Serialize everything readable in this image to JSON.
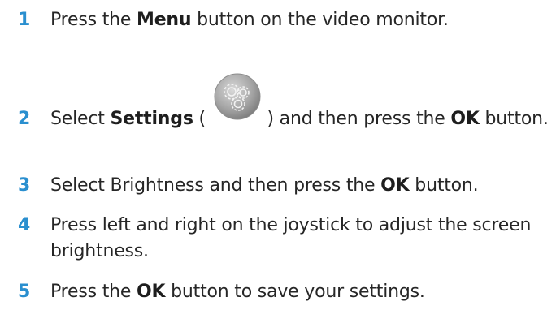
{
  "steps": [
    {
      "number": "1",
      "pre": "Press the ",
      "bold": "Menu",
      "post": " button on the video monitor."
    },
    {
      "number": "2",
      "pre": "Select ",
      "bold": "Settings",
      "mid": " ( ",
      "mid2": " ) and then press the ",
      "bold2": "OK",
      "post": " button.",
      "icon": "settings-gears-icon"
    },
    {
      "number": "3",
      "pre": "Select Brightness and then press the ",
      "bold": "OK",
      "post": " button."
    },
    {
      "number": "4",
      "pre": "Press left and right on the joystick to adjust the screen brightness."
    },
    {
      "number": "5",
      "pre": "Press the ",
      "bold": "OK",
      "post": " button to save your settings."
    }
  ],
  "colors": {
    "step_number": "#2a8fcf",
    "text": "#262626",
    "icon_gray": "#9a9a9a"
  }
}
